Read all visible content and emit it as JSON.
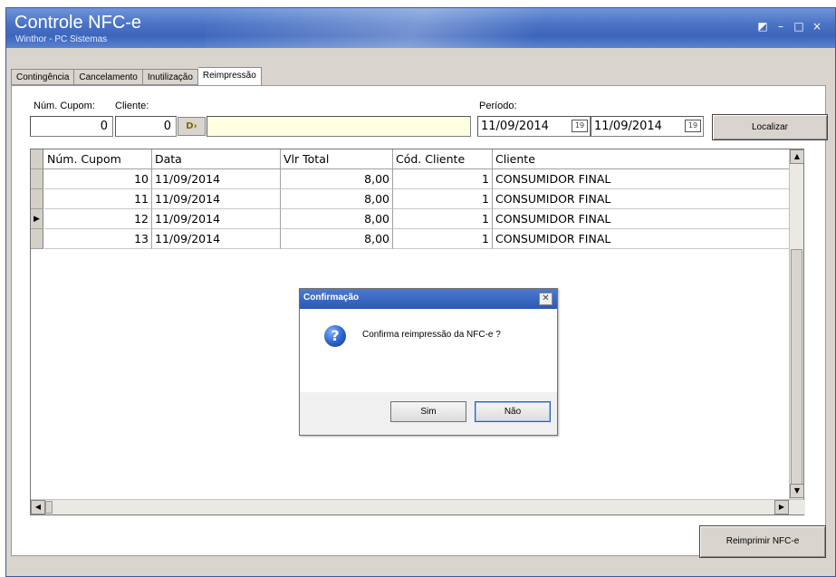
{
  "window": {
    "title": "Controle NFC-e",
    "subtitle": "Winthor - PC Sistemas"
  },
  "tabs": [
    {
      "label": "Contingência"
    },
    {
      "label": "Cancelamento"
    },
    {
      "label": "Inutilização"
    },
    {
      "label": "Reimpressão"
    }
  ],
  "filters": {
    "cupom_label": "Núm. Cupom:",
    "cliente_label": "Cliente:",
    "cupom_value": "0",
    "cliente_value": "0",
    "cliente_name_value": "",
    "periodo_label": "Período:",
    "date_start": "11/09/2014",
    "date_end": "11/09/2014",
    "calendar_icon_glyph": "19",
    "localizar_label": "Localizar"
  },
  "grid": {
    "columns": [
      "Núm. Cupom",
      "Data",
      "Vlr Total",
      "Cód. Cliente",
      "Cliente"
    ],
    "rows": [
      [
        "10",
        "11/09/2014",
        "8,00",
        "1",
        "CONSUMIDOR FINAL"
      ],
      [
        "11",
        "11/09/2014",
        "8,00",
        "1",
        "CONSUMIDOR FINAL"
      ],
      [
        "12",
        "11/09/2014",
        "8,00",
        "1",
        "CONSUMIDOR FINAL"
      ],
      [
        "13",
        "11/09/2014",
        "8,00",
        "1",
        "CONSUMIDOR FINAL"
      ]
    ],
    "selected_row_marker": "▶"
  },
  "dialog": {
    "title": "Confirmação",
    "message": "Confirma reimpressão da NFC-e ?",
    "yes_label": "Sim",
    "no_label": "Não",
    "icon": "question-icon"
  },
  "actions": {
    "reimprimir_label": "Reimprimir NFC-e"
  }
}
